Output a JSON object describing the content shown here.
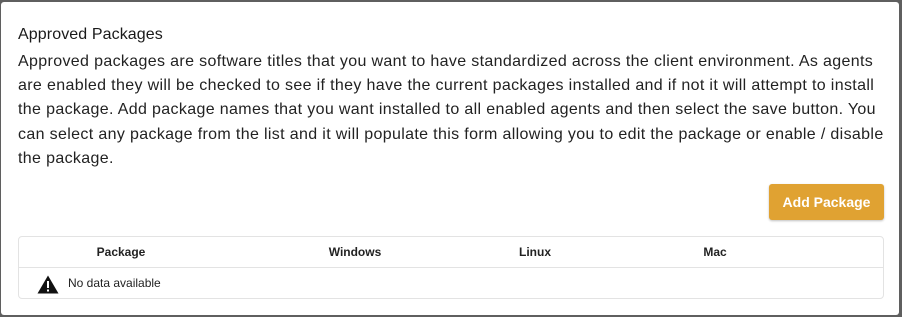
{
  "section": {
    "title": "Approved Packages",
    "description": "Approved packages are software titles that you want to have standardized across the client environment. As agents are enabled they will be checked to see if they have the current packages installed and if not it will attempt to install the package. Add package names that you want installed to all enabled agents and then select the save button. You can select any package from the list and it will populate this form allowing you to edit the package or enable / disable the package."
  },
  "actions": {
    "add_label": "Add Package",
    "add_color": "#e0a232"
  },
  "table": {
    "columns": [
      "Package",
      "Windows",
      "Linux",
      "Mac"
    ],
    "empty_text": "No data available",
    "empty_icon": "warning-icon"
  }
}
